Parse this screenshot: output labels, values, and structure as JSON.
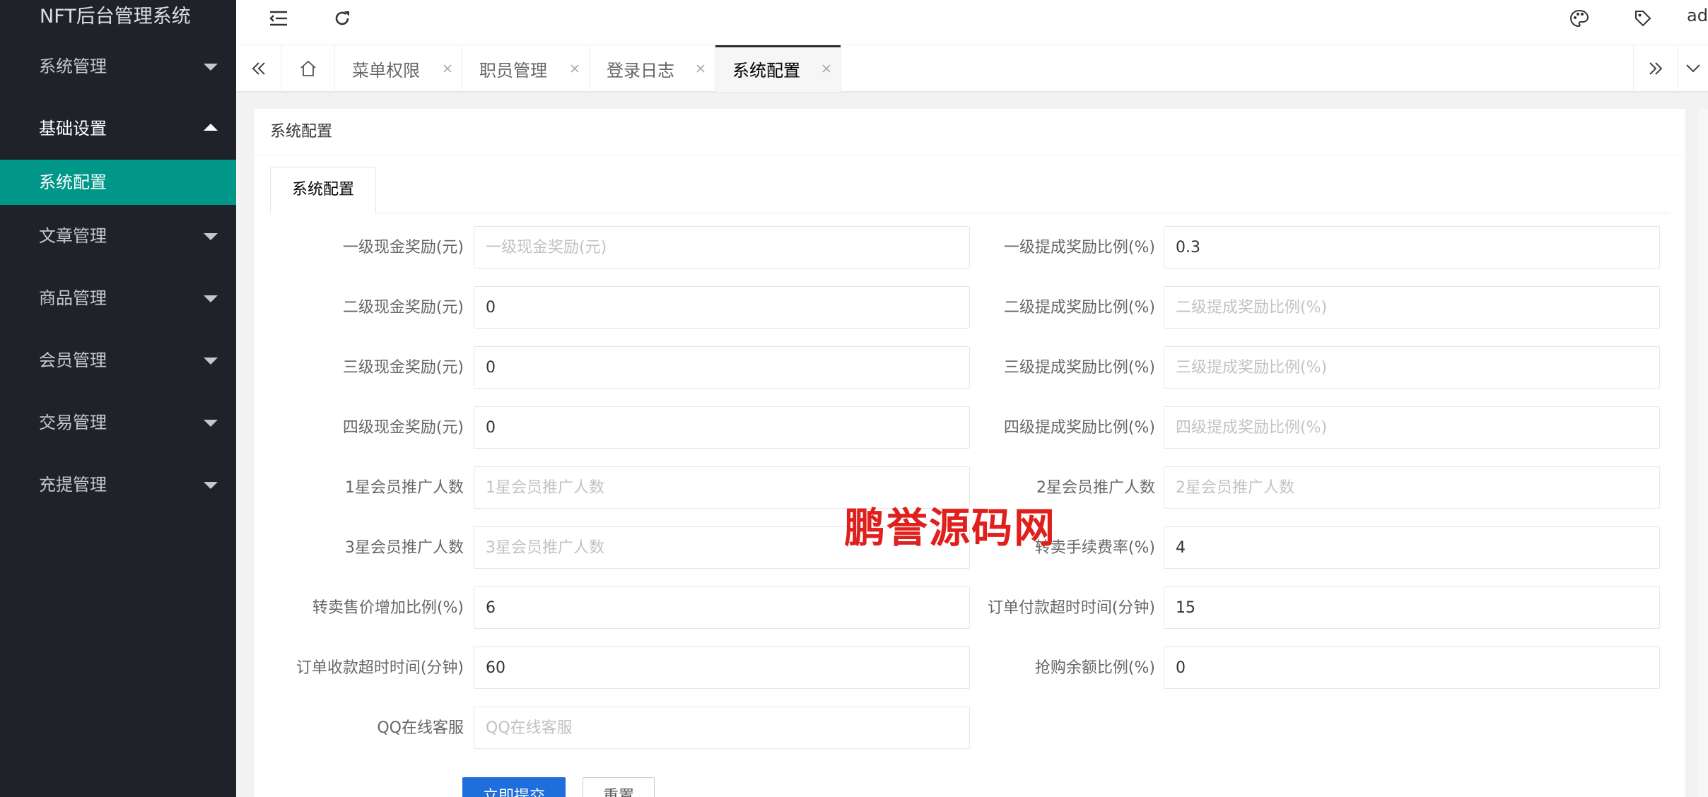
{
  "app": {
    "title": "NFT后台管理系统",
    "user_short": "ad"
  },
  "sidebar": {
    "items": [
      {
        "label": "系统管理",
        "state": "collapsed"
      },
      {
        "label": "基础设置",
        "state": "expanded",
        "children": [
          {
            "label": "系统配置",
            "active": true
          }
        ]
      },
      {
        "label": "文章管理",
        "state": "collapsed"
      },
      {
        "label": "商品管理",
        "state": "collapsed"
      },
      {
        "label": "会员管理",
        "state": "collapsed"
      },
      {
        "label": "交易管理",
        "state": "collapsed"
      },
      {
        "label": "充提管理",
        "state": "collapsed"
      }
    ]
  },
  "header": {
    "icons": [
      "menu-fold-icon",
      "refresh-icon",
      "palette-icon",
      "tag-icon"
    ]
  },
  "tabs": [
    {
      "label": "菜单权限"
    },
    {
      "label": "职员管理"
    },
    {
      "label": "登录日志"
    },
    {
      "label": "系统配置",
      "active": true
    }
  ],
  "card": {
    "title": "系统配置",
    "tab": "系统配置"
  },
  "form": {
    "rows": [
      {
        "left": {
          "label": "一级现金奖励(元)",
          "value": "",
          "placeholder": "一级现金奖励(元)"
        },
        "right": {
          "label": "一级提成奖励比例(%)",
          "value": "0.3",
          "placeholder": "一级提成奖励比例(%)"
        }
      },
      {
        "left": {
          "label": "二级现金奖励(元)",
          "value": "0",
          "placeholder": "二级现金奖励(元)"
        },
        "right": {
          "label": "二级提成奖励比例(%)",
          "value": "",
          "placeholder": "二级提成奖励比例(%)"
        }
      },
      {
        "left": {
          "label": "三级现金奖励(元)",
          "value": "0",
          "placeholder": "三级现金奖励(元)"
        },
        "right": {
          "label": "三级提成奖励比例(%)",
          "value": "",
          "placeholder": "三级提成奖励比例(%)"
        }
      },
      {
        "left": {
          "label": "四级现金奖励(元)",
          "value": "0",
          "placeholder": "四级现金奖励(元)"
        },
        "right": {
          "label": "四级提成奖励比例(%)",
          "value": "",
          "placeholder": "四级提成奖励比例(%)"
        }
      },
      {
        "left": {
          "label": "1星会员推广人数",
          "value": "",
          "placeholder": "1星会员推广人数"
        },
        "right": {
          "label": "2星会员推广人数",
          "value": "",
          "placeholder": "2星会员推广人数"
        }
      },
      {
        "left": {
          "label": "3星会员推广人数",
          "value": "",
          "placeholder": "3星会员推广人数"
        },
        "right": {
          "label": "转卖手续费率(%)",
          "value": "4",
          "placeholder": "转卖手续费率(%)"
        }
      },
      {
        "left": {
          "label": "转卖售价增加比例(%)",
          "value": "6",
          "placeholder": "转卖售价增加比例(%)"
        },
        "right": {
          "label": "订单付款超时时间(分钟)",
          "value": "15",
          "placeholder": "订单付款超时时间(分钟)"
        }
      },
      {
        "left": {
          "label": "订单收款超时时间(分钟)",
          "value": "60",
          "placeholder": "订单收款超时时间(分钟)"
        },
        "right": {
          "label": "抢购余额比例(%)",
          "value": "0",
          "placeholder": "抢购余额比例(%)"
        }
      },
      {
        "left": {
          "label": "QQ在线客服",
          "value": "",
          "placeholder": "QQ在线客服"
        }
      }
    ],
    "submit_label": "立即提交",
    "reset_label": "重置"
  },
  "watermark": "鹏誉源码网",
  "colors": {
    "sidebar_bg": "#20222a",
    "accent": "#009688",
    "primary": "#1e6fdc",
    "watermark": "#e0201c"
  }
}
